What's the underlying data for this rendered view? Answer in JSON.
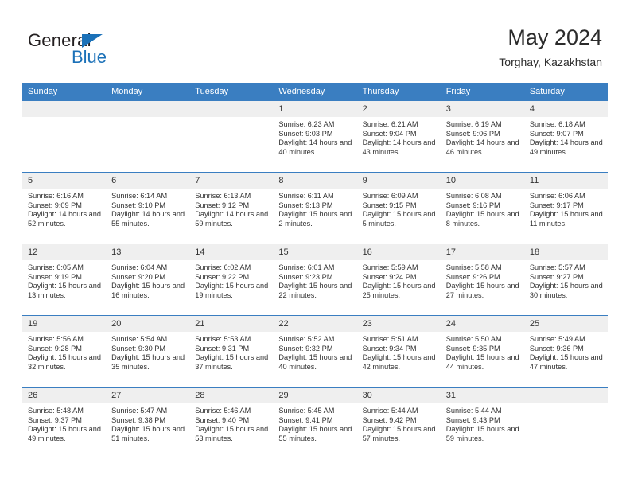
{
  "brand": {
    "name_part1": "General",
    "name_part2": "Blue",
    "triangle_color": "#1b71b8",
    "text_color": "#231f20"
  },
  "header": {
    "month_title": "May 2024",
    "location": "Torghay, Kazakhstan"
  },
  "theme": {
    "header_blue": "#3a7ec1",
    "daynum_band": "#efefef",
    "text": "#333333"
  },
  "calendar": {
    "weekday_headers": [
      "Sunday",
      "Monday",
      "Tuesday",
      "Wednesday",
      "Thursday",
      "Friday",
      "Saturday"
    ],
    "weeks": [
      [
        {
          "day": "",
          "empty": true
        },
        {
          "day": "",
          "empty": true
        },
        {
          "day": "",
          "empty": true
        },
        {
          "day": "1",
          "sunrise": "Sunrise: 6:23 AM",
          "sunset": "Sunset: 9:03 PM",
          "daylight": "Daylight: 14 hours and 40 minutes."
        },
        {
          "day": "2",
          "sunrise": "Sunrise: 6:21 AM",
          "sunset": "Sunset: 9:04 PM",
          "daylight": "Daylight: 14 hours and 43 minutes."
        },
        {
          "day": "3",
          "sunrise": "Sunrise: 6:19 AM",
          "sunset": "Sunset: 9:06 PM",
          "daylight": "Daylight: 14 hours and 46 minutes."
        },
        {
          "day": "4",
          "sunrise": "Sunrise: 6:18 AM",
          "sunset": "Sunset: 9:07 PM",
          "daylight": "Daylight: 14 hours and 49 minutes."
        }
      ],
      [
        {
          "day": "5",
          "sunrise": "Sunrise: 6:16 AM",
          "sunset": "Sunset: 9:09 PM",
          "daylight": "Daylight: 14 hours and 52 minutes."
        },
        {
          "day": "6",
          "sunrise": "Sunrise: 6:14 AM",
          "sunset": "Sunset: 9:10 PM",
          "daylight": "Daylight: 14 hours and 55 minutes."
        },
        {
          "day": "7",
          "sunrise": "Sunrise: 6:13 AM",
          "sunset": "Sunset: 9:12 PM",
          "daylight": "Daylight: 14 hours and 59 minutes."
        },
        {
          "day": "8",
          "sunrise": "Sunrise: 6:11 AM",
          "sunset": "Sunset: 9:13 PM",
          "daylight": "Daylight: 15 hours and 2 minutes."
        },
        {
          "day": "9",
          "sunrise": "Sunrise: 6:09 AM",
          "sunset": "Sunset: 9:15 PM",
          "daylight": "Daylight: 15 hours and 5 minutes."
        },
        {
          "day": "10",
          "sunrise": "Sunrise: 6:08 AM",
          "sunset": "Sunset: 9:16 PM",
          "daylight": "Daylight: 15 hours and 8 minutes."
        },
        {
          "day": "11",
          "sunrise": "Sunrise: 6:06 AM",
          "sunset": "Sunset: 9:17 PM",
          "daylight": "Daylight: 15 hours and 11 minutes."
        }
      ],
      [
        {
          "day": "12",
          "sunrise": "Sunrise: 6:05 AM",
          "sunset": "Sunset: 9:19 PM",
          "daylight": "Daylight: 15 hours and 13 minutes."
        },
        {
          "day": "13",
          "sunrise": "Sunrise: 6:04 AM",
          "sunset": "Sunset: 9:20 PM",
          "daylight": "Daylight: 15 hours and 16 minutes."
        },
        {
          "day": "14",
          "sunrise": "Sunrise: 6:02 AM",
          "sunset": "Sunset: 9:22 PM",
          "daylight": "Daylight: 15 hours and 19 minutes."
        },
        {
          "day": "15",
          "sunrise": "Sunrise: 6:01 AM",
          "sunset": "Sunset: 9:23 PM",
          "daylight": "Daylight: 15 hours and 22 minutes."
        },
        {
          "day": "16",
          "sunrise": "Sunrise: 5:59 AM",
          "sunset": "Sunset: 9:24 PM",
          "daylight": "Daylight: 15 hours and 25 minutes."
        },
        {
          "day": "17",
          "sunrise": "Sunrise: 5:58 AM",
          "sunset": "Sunset: 9:26 PM",
          "daylight": "Daylight: 15 hours and 27 minutes."
        },
        {
          "day": "18",
          "sunrise": "Sunrise: 5:57 AM",
          "sunset": "Sunset: 9:27 PM",
          "daylight": "Daylight: 15 hours and 30 minutes."
        }
      ],
      [
        {
          "day": "19",
          "sunrise": "Sunrise: 5:56 AM",
          "sunset": "Sunset: 9:28 PM",
          "daylight": "Daylight: 15 hours and 32 minutes."
        },
        {
          "day": "20",
          "sunrise": "Sunrise: 5:54 AM",
          "sunset": "Sunset: 9:30 PM",
          "daylight": "Daylight: 15 hours and 35 minutes."
        },
        {
          "day": "21",
          "sunrise": "Sunrise: 5:53 AM",
          "sunset": "Sunset: 9:31 PM",
          "daylight": "Daylight: 15 hours and 37 minutes."
        },
        {
          "day": "22",
          "sunrise": "Sunrise: 5:52 AM",
          "sunset": "Sunset: 9:32 PM",
          "daylight": "Daylight: 15 hours and 40 minutes."
        },
        {
          "day": "23",
          "sunrise": "Sunrise: 5:51 AM",
          "sunset": "Sunset: 9:34 PM",
          "daylight": "Daylight: 15 hours and 42 minutes."
        },
        {
          "day": "24",
          "sunrise": "Sunrise: 5:50 AM",
          "sunset": "Sunset: 9:35 PM",
          "daylight": "Daylight: 15 hours and 44 minutes."
        },
        {
          "day": "25",
          "sunrise": "Sunrise: 5:49 AM",
          "sunset": "Sunset: 9:36 PM",
          "daylight": "Daylight: 15 hours and 47 minutes."
        }
      ],
      [
        {
          "day": "26",
          "sunrise": "Sunrise: 5:48 AM",
          "sunset": "Sunset: 9:37 PM",
          "daylight": "Daylight: 15 hours and 49 minutes."
        },
        {
          "day": "27",
          "sunrise": "Sunrise: 5:47 AM",
          "sunset": "Sunset: 9:38 PM",
          "daylight": "Daylight: 15 hours and 51 minutes."
        },
        {
          "day": "28",
          "sunrise": "Sunrise: 5:46 AM",
          "sunset": "Sunset: 9:40 PM",
          "daylight": "Daylight: 15 hours and 53 minutes."
        },
        {
          "day": "29",
          "sunrise": "Sunrise: 5:45 AM",
          "sunset": "Sunset: 9:41 PM",
          "daylight": "Daylight: 15 hours and 55 minutes."
        },
        {
          "day": "30",
          "sunrise": "Sunrise: 5:44 AM",
          "sunset": "Sunset: 9:42 PM",
          "daylight": "Daylight: 15 hours and 57 minutes."
        },
        {
          "day": "31",
          "sunrise": "Sunrise: 5:44 AM",
          "sunset": "Sunset: 9:43 PM",
          "daylight": "Daylight: 15 hours and 59 minutes."
        },
        {
          "day": "",
          "empty": true
        }
      ]
    ]
  }
}
